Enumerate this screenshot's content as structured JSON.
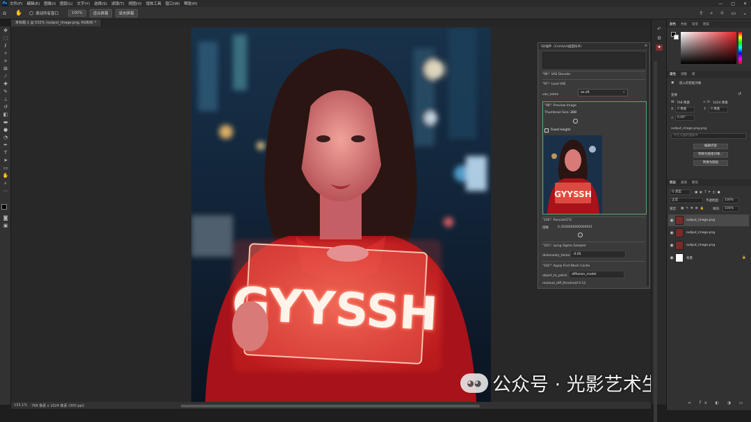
{
  "menubar": {
    "items": [
      "文件(F)",
      "编辑(E)",
      "图像(I)",
      "图层(L)",
      "文字(Y)",
      "选择(S)",
      "滤镜(T)",
      "视图(V)",
      "增效工具",
      "窗口(W)",
      "帮助(H)"
    ],
    "window_controls": [
      "—",
      "□",
      "✕"
    ]
  },
  "optionsbar": {
    "scroll_all_label": "滚动所有窗口",
    "zoom_100": "100%",
    "fit_screen": "适合屏幕",
    "fill_screen": "填充屏幕"
  },
  "document": {
    "tab_label": "未标题-1 @ 532% (output_image.png, RGB/8) *",
    "zoom_status": "133.1%",
    "size_status": "768 像素 x 1024 像素 (300 ppi)"
  },
  "photo": {
    "sign_text": "GYYSSH",
    "watermark": "公众号 · 光影艺术生活馆"
  },
  "float_panel": {
    "title": "SD插件（ComfyUI画面技术）",
    "vae_decode": "\"96\": VAE Decode",
    "load_vae": "\"97\": Load VAE",
    "vae_name_label": "vae_name",
    "vae_name_value": "ae.sft",
    "preview_title": "\"98\": Preview Image",
    "thumb_size_label": "Thumbnail Size:",
    "thumb_size_value": "200",
    "fixed_height": "Fixed Height:",
    "rescale_title": "\"100\": RescaleCFG",
    "multiplier_label": "倍数",
    "multiplier_value": "0.3500000000000001",
    "lying_sigma": "\"101\": Lying Sigma Sampler",
    "dishonesty_label": "dishonesty_factor",
    "dishonesty_value": "-0.05",
    "fbc_title": "\"102\": Apply First Block Cache",
    "object_label": "object_to_patch",
    "object_value": "diffusion_model",
    "residual_label": "residual_diff_threshold 0.12"
  },
  "right_panel": {
    "color_tabs": [
      "颜色",
      "色板",
      "渐变",
      "图案"
    ],
    "props_tabs": [
      "属性",
      "调整",
      "库"
    ],
    "smart_object_label": "嵌入的智能对象",
    "transform_label": "变换",
    "w_label": "W:",
    "w_value": "768 像素",
    "h_label": "H:",
    "h_value": "1024 像素",
    "x_label": "X:",
    "x_value": "0 像素",
    "y_label": "Y:",
    "y_value": "0 像素",
    "angle_value": "0.00°",
    "filename": "output_image.png.png",
    "fg_placeholder": "不在页面的面板中",
    "btn_edit": "编辑内容",
    "btn_convert_layers": "转换为链接对象...",
    "btn_convert_layer": "转换为图层",
    "layers_tabs": [
      "图层",
      "通道",
      "路径"
    ],
    "kind_label": "Q 类型",
    "blend_mode": "正常",
    "opacity_label": "不透明度:",
    "opacity_value": "100%",
    "lock_label": "锁定:",
    "fill_label": "填充:",
    "fill_value": "100%",
    "layers": [
      {
        "name": "output_image.png",
        "selected": true
      },
      {
        "name": "output_image.png",
        "selected": false
      },
      {
        "name": "output_image.png",
        "selected": false
      },
      {
        "name": "背景",
        "selected": false
      }
    ]
  },
  "colors": {
    "accent": "#31a8ff",
    "sign_glow": "#ff5a4a",
    "jacket": "#b0141c"
  }
}
